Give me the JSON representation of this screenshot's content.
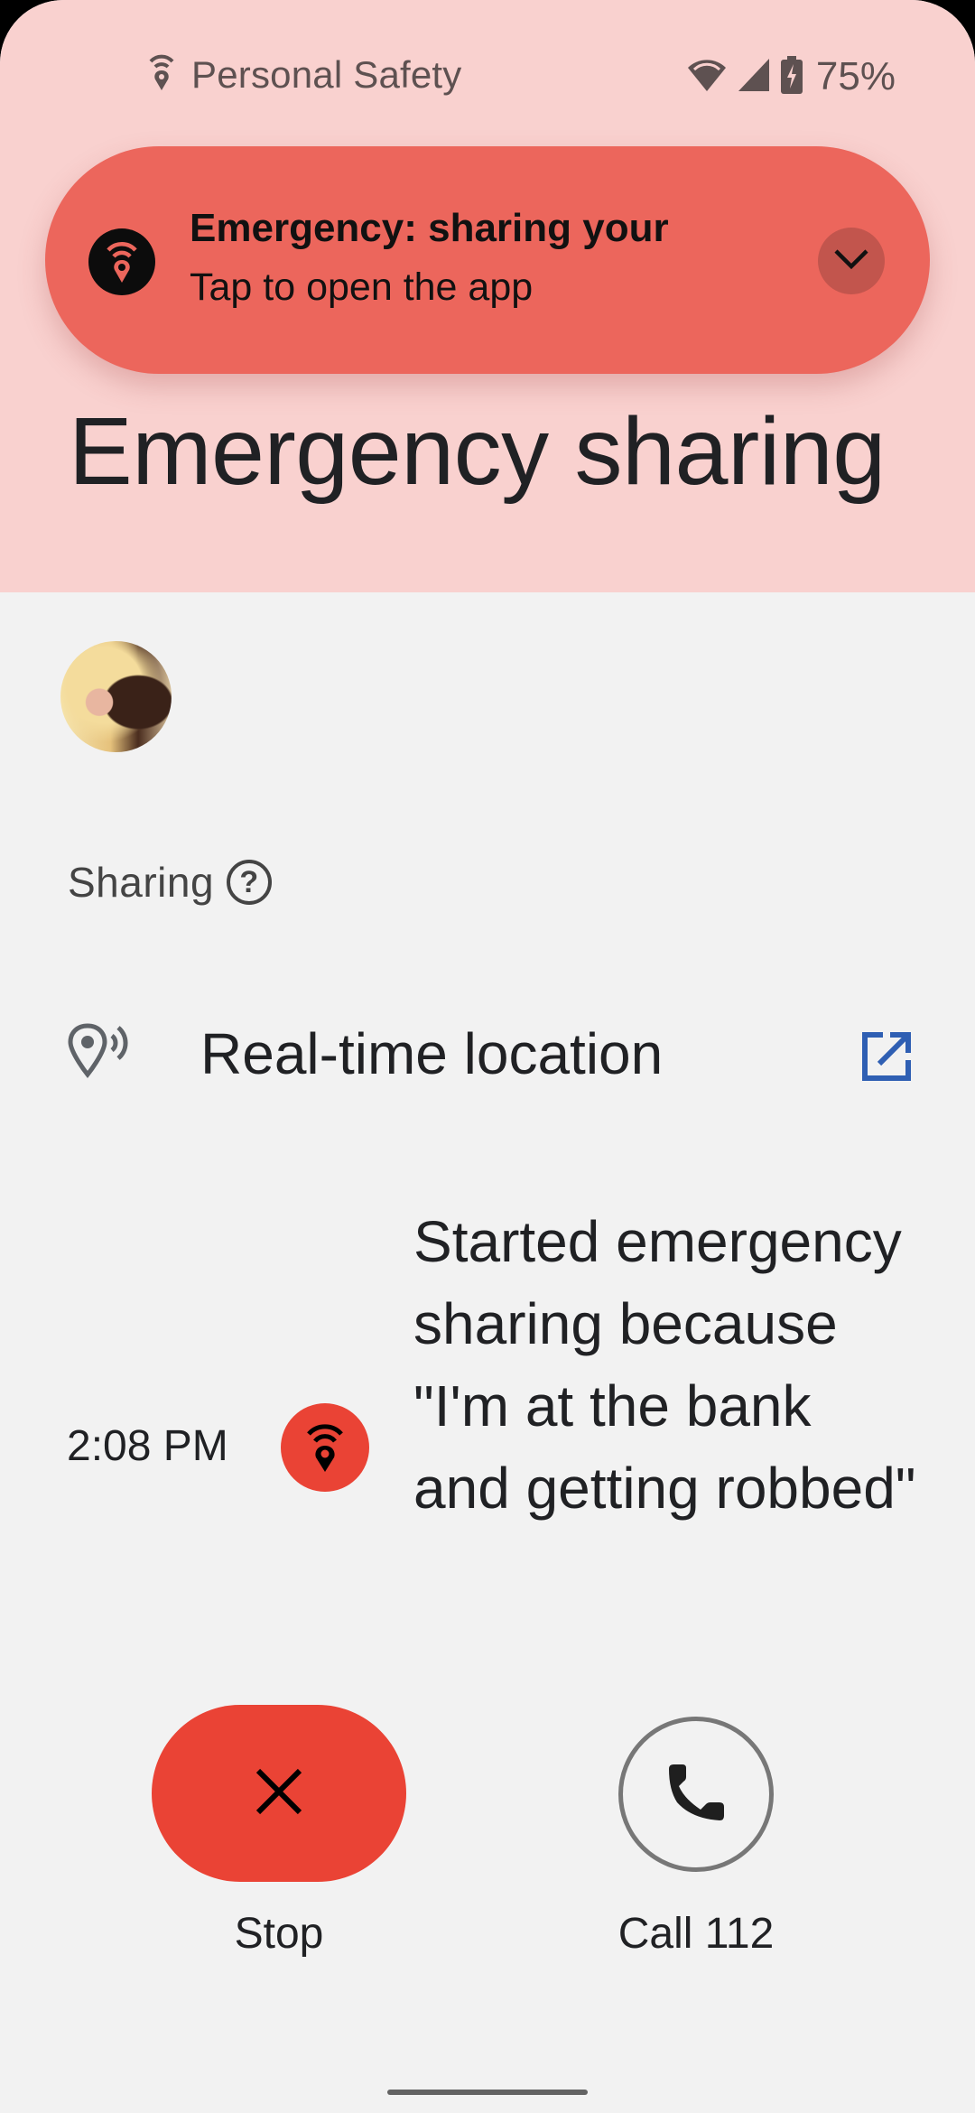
{
  "status_bar": {
    "app_name": "Personal Safety",
    "battery": "75%",
    "icons": [
      "personal-safety-icon",
      "wifi-icon",
      "cellular-signal-icon",
      "battery-charging-icon"
    ]
  },
  "notification": {
    "title": "Emergency: sharing your",
    "subtitle": "Tap to open the app",
    "icon": "emergency-sharing-icon",
    "expand_icon": "chevron-down-icon"
  },
  "page": {
    "title": "Emergency sharing"
  },
  "sharing": {
    "label": "Sharing",
    "help_glyph": "?",
    "items": [
      {
        "label": "Real-time location",
        "icon": "location-pin-broadcast-icon",
        "action_icon": "open-external-icon"
      }
    ]
  },
  "timeline": [
    {
      "time": "2:08 PM",
      "icon": "emergency-sharing-icon",
      "text": "Started emergency sharing because \"I'm at the bank and getting robbed\""
    }
  ],
  "actions": {
    "stop_label": "Stop",
    "call_label": "Call 112"
  },
  "colors": {
    "header_bg": "#f9d1cf",
    "notification_bg": "#ec665c",
    "accent_red": "#ea4335",
    "link_blue": "#2f5fb3",
    "page_bg": "#f2f2f2"
  }
}
